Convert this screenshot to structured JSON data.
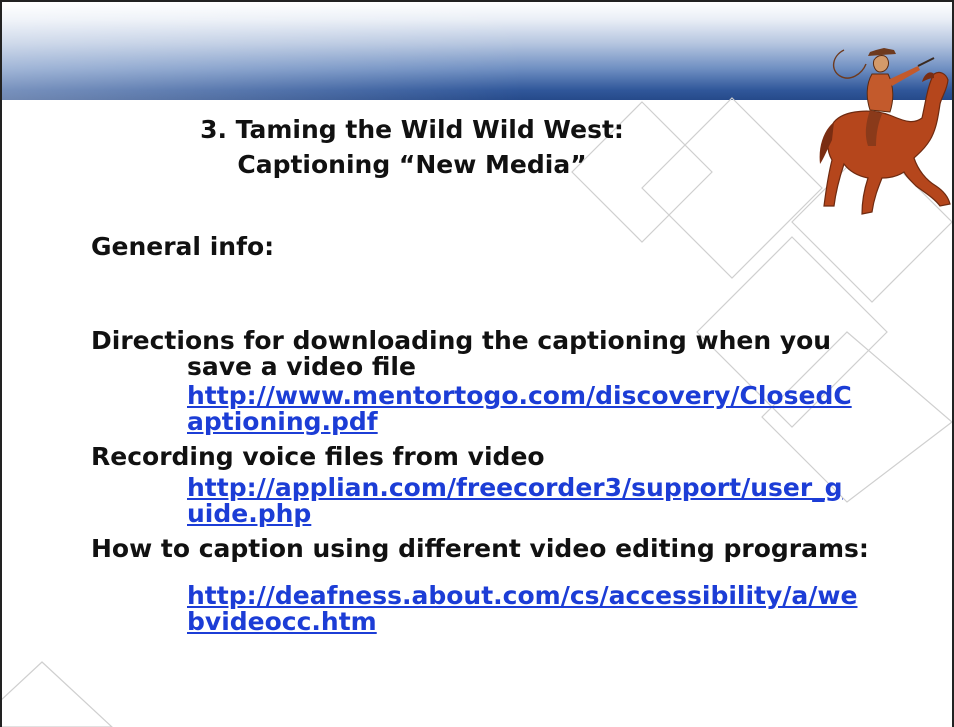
{
  "slide": {
    "title_line1": "3. Taming the Wild Wild West:",
    "title_line2": "Captioning “New Media”",
    "general_info": "General info:",
    "items": [
      {
        "heading_line1": "Directions for downloading the captioning when you",
        "heading_line2": "save a video file",
        "link_line1": "http://www.mentortogo.com/discovery/ClosedC",
        "link_line2": "aptioning.pdf"
      },
      {
        "heading_line1": "Recording voice files from video",
        "link_line1": "http://applian.com/freecorder3/support/user_g",
        "link_line2": "uide.php"
      },
      {
        "heading_line1": "How to caption  using different video editing programs:",
        "link_line1": "http://deafness.about.com/cs/accessibility/a/we",
        "link_line2": "bvideocc.htm"
      }
    ]
  },
  "colors": {
    "header_blue": "#30579a",
    "link_blue": "#1c3dd6",
    "diamond_stroke": "#c8c8c8",
    "horse_red": "#b5461c"
  },
  "icons": [
    "diamond-decoration",
    "cowboy-on-horse-icon"
  ]
}
